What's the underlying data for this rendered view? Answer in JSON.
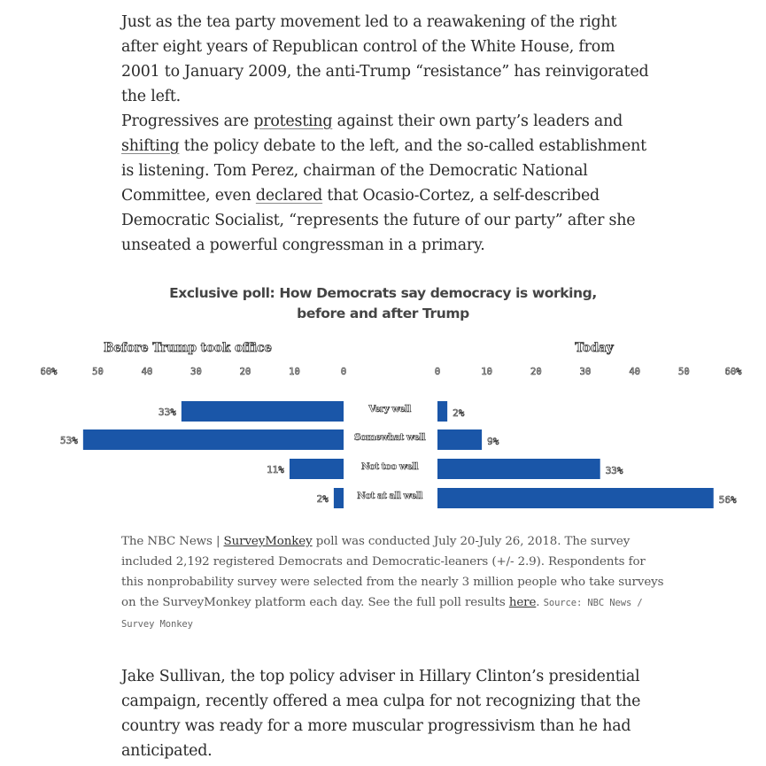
{
  "article": {
    "p1": "Just as the tea party movement led to a reawakening of the right after eight years of Republican control of the White House, from 2001 to January 2009, the anti-Trump “resistance” has reinvigorated the left.",
    "p2": {
      "t1": "Progressives are ",
      "link1": "protesting",
      "t2": " against their own party’s leaders and ",
      "link2": "shifting",
      "t3": " the policy debate to the left, and the so-called establishment is listening. Tom Perez, chairman of the Democratic National Committee, even ",
      "link3": "declared",
      "t4": " that Ocasio-Cortez, a self-described Democratic Socialist, “represents the future of our party” after she unseated a powerful congressman in a primary."
    },
    "p3": "Jake Sullivan, the top policy adviser in Hillary Clinton’s presidential campaign, recently offered a mea culpa for not recognizing that the country was ready for a more muscular progressivism than he had anticipated."
  },
  "chart_data": {
    "type": "bar",
    "title_line1": "Exclusive poll: How Democrats say democracy is working,",
    "title_line2": "before and after Trump",
    "categories": [
      "Very well",
      "Somewhat well",
      "Not too well",
      "Not at all well"
    ],
    "series": [
      {
        "name": "Before Trump took office",
        "values": [
          33,
          53,
          11,
          2
        ],
        "labels": [
          "33%",
          "53%",
          "11%",
          "2%"
        ],
        "ticks": [
          "60%",
          "50",
          "40",
          "30",
          "20",
          "10",
          "0"
        ],
        "xlim": [
          0,
          60
        ]
      },
      {
        "name": "Today",
        "values": [
          2,
          9,
          33,
          56
        ],
        "labels": [
          "2%",
          "9%",
          "33%",
          "56%"
        ],
        "ticks": [
          "0",
          "10",
          "20",
          "30",
          "40",
          "50",
          "60%"
        ],
        "xlim": [
          0,
          60
        ]
      }
    ],
    "bar_color": "#1a56a8"
  },
  "note": {
    "t1": "The NBC News | ",
    "link1": "SurveyMonkey",
    "t2": " poll was conducted July 20-July 26, 2018. The survey included 2,192 registered Democrats and Democratic-leaners (+/- 2.9). Respondents for this nonprobability survey were selected from the nearly 3 million people who take surveys on the SurveyMonkey platform each day. See the full poll results ",
    "link2": "here",
    "t3": ". ",
    "source": "Source: NBC News / Survey Monkey"
  }
}
